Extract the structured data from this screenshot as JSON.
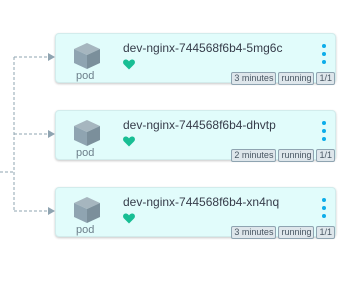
{
  "colors": {
    "node_background": "#e1fcfb",
    "health_healthy": "#18be94",
    "menu_accent": "#0dadea",
    "edge": "#8fa4b1"
  },
  "nodes": [
    {
      "name": "dev-nginx-744568f6b4-5mg6c",
      "kind": "pod",
      "icon": "cube-icon",
      "health": "heart-icon",
      "age": "3 minutes",
      "status": "running",
      "ready": "1/1"
    },
    {
      "name": "dev-nginx-744568f6b4-dhvtp",
      "kind": "pod",
      "icon": "cube-icon",
      "health": "heart-icon",
      "age": "2 minutes",
      "status": "running",
      "ready": "1/1"
    },
    {
      "name": "dev-nginx-744568f6b4-xn4nq",
      "kind": "pod",
      "icon": "cube-icon",
      "health": "heart-icon",
      "age": "3 minutes",
      "status": "running",
      "ready": "1/1"
    }
  ]
}
